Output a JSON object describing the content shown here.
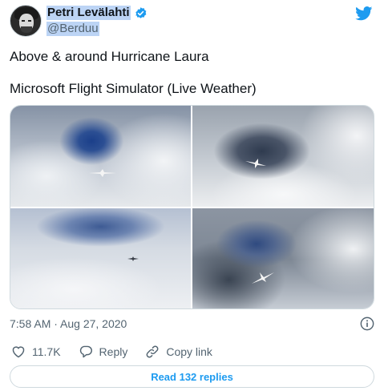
{
  "author": {
    "display_name": "Petri Levälahti",
    "handle": "@Berduu",
    "verified": true
  },
  "tweet": {
    "line1": "Above & around Hurricane Laura",
    "line2": "Microsoft Flight Simulator (Live Weather)"
  },
  "media": {
    "photo_count": 4
  },
  "meta": {
    "timestamp": "7:58 AM · Aug 27, 2020"
  },
  "actions": {
    "likes": "11.7K",
    "reply_label": "Reply",
    "copy_label": "Copy link"
  },
  "read_replies_label": "Read 132 replies",
  "colors": {
    "accent": "#1d9bf0",
    "secondary_text": "#536471",
    "border": "#cfd9de",
    "highlight": "#bcd4f5"
  },
  "icons": [
    "twitter-bird-icon",
    "verified-badge-icon",
    "info-icon",
    "heart-icon",
    "reply-icon",
    "link-icon"
  ]
}
